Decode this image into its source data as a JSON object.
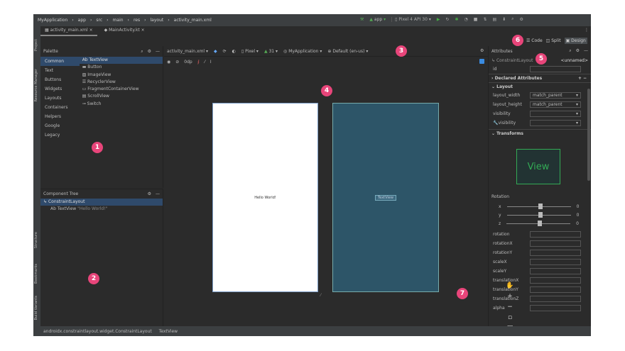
{
  "title_bar": {
    "breadcrumb": [
      "MyApplication",
      "app",
      "src",
      "main",
      "res",
      "layout",
      "activity_main.xml"
    ],
    "run_config": "app",
    "device": "Pixel 4 API 30"
  },
  "tabs": [
    {
      "label": "activity_main.xml",
      "active": true
    },
    {
      "label": "MainActivity.kt",
      "active": false
    }
  ],
  "view_modes": {
    "code": "Code",
    "split": "Split",
    "design": "Design",
    "selected": "Design"
  },
  "side_tools": {
    "project": "Project",
    "resource_manager": "Resource Manager",
    "structure": "Structure",
    "bookmarks": "Bookmarks",
    "build_variants": "Build Variants"
  },
  "palette": {
    "title": "Palette",
    "categories": [
      "Common",
      "Text",
      "Buttons",
      "Widgets",
      "Layouts",
      "Containers",
      "Helpers",
      "Google",
      "Legacy"
    ],
    "selected_category": "Common",
    "items": [
      {
        "icon": "text-icon",
        "label": "TextView"
      },
      {
        "icon": "button-icon",
        "label": "Button"
      },
      {
        "icon": "image-icon",
        "label": "ImageView"
      },
      {
        "icon": "list-icon",
        "label": "RecyclerView"
      },
      {
        "icon": "container-icon",
        "label": "FragmentContainerView"
      },
      {
        "icon": "scroll-icon",
        "label": "ScrollView"
      },
      {
        "icon": "switch-icon",
        "label": "Switch"
      }
    ]
  },
  "component_tree": {
    "title": "Component Tree",
    "root": "ConstraintLayout",
    "child": {
      "label": "TextView",
      "text": "\"Hello World!\""
    }
  },
  "design_toolbar": {
    "file": "activity_main.xml",
    "device": "Pixel",
    "api": "31",
    "theme": "MyApplication",
    "locale": "Default (en-us)",
    "margin": "0dp"
  },
  "canvas": {
    "design_text": "Hello World!",
    "blueprint_text": "TextView",
    "design_bg": "#ffffff",
    "blueprint_bg": "#2d5568"
  },
  "attributes": {
    "title": "Attributes",
    "component": "ConstraintLayout",
    "id_value": "<unnamed>",
    "id_label": "id",
    "declared": "Declared Attributes",
    "layout_section": "Layout",
    "layout_rows": [
      {
        "label": "layout_width",
        "value": "match_parent"
      },
      {
        "label": "layout_height",
        "value": "match_parent"
      },
      {
        "label": "visibility",
        "value": ""
      },
      {
        "label": "visibility",
        "value": ""
      }
    ],
    "transforms": "Transforms",
    "preview": "View",
    "rotation": "Rotation",
    "rotation_axes": [
      {
        "axis": "x",
        "value": "0"
      },
      {
        "axis": "y",
        "value": "0"
      },
      {
        "axis": "z",
        "value": "0"
      }
    ],
    "transform_rows": [
      "rotation",
      "rotationX",
      "rotationY",
      "scaleX",
      "scaleY",
      "translationX",
      "translationY",
      "translationZ",
      "alpha"
    ]
  },
  "status_bar": {
    "path": "androidx.constraintlayout.widget.ConstraintLayout",
    "child": "TextView"
  },
  "callouts": [
    "1",
    "2",
    "3",
    "4",
    "5",
    "6",
    "7"
  ],
  "accent": "#e8457a"
}
